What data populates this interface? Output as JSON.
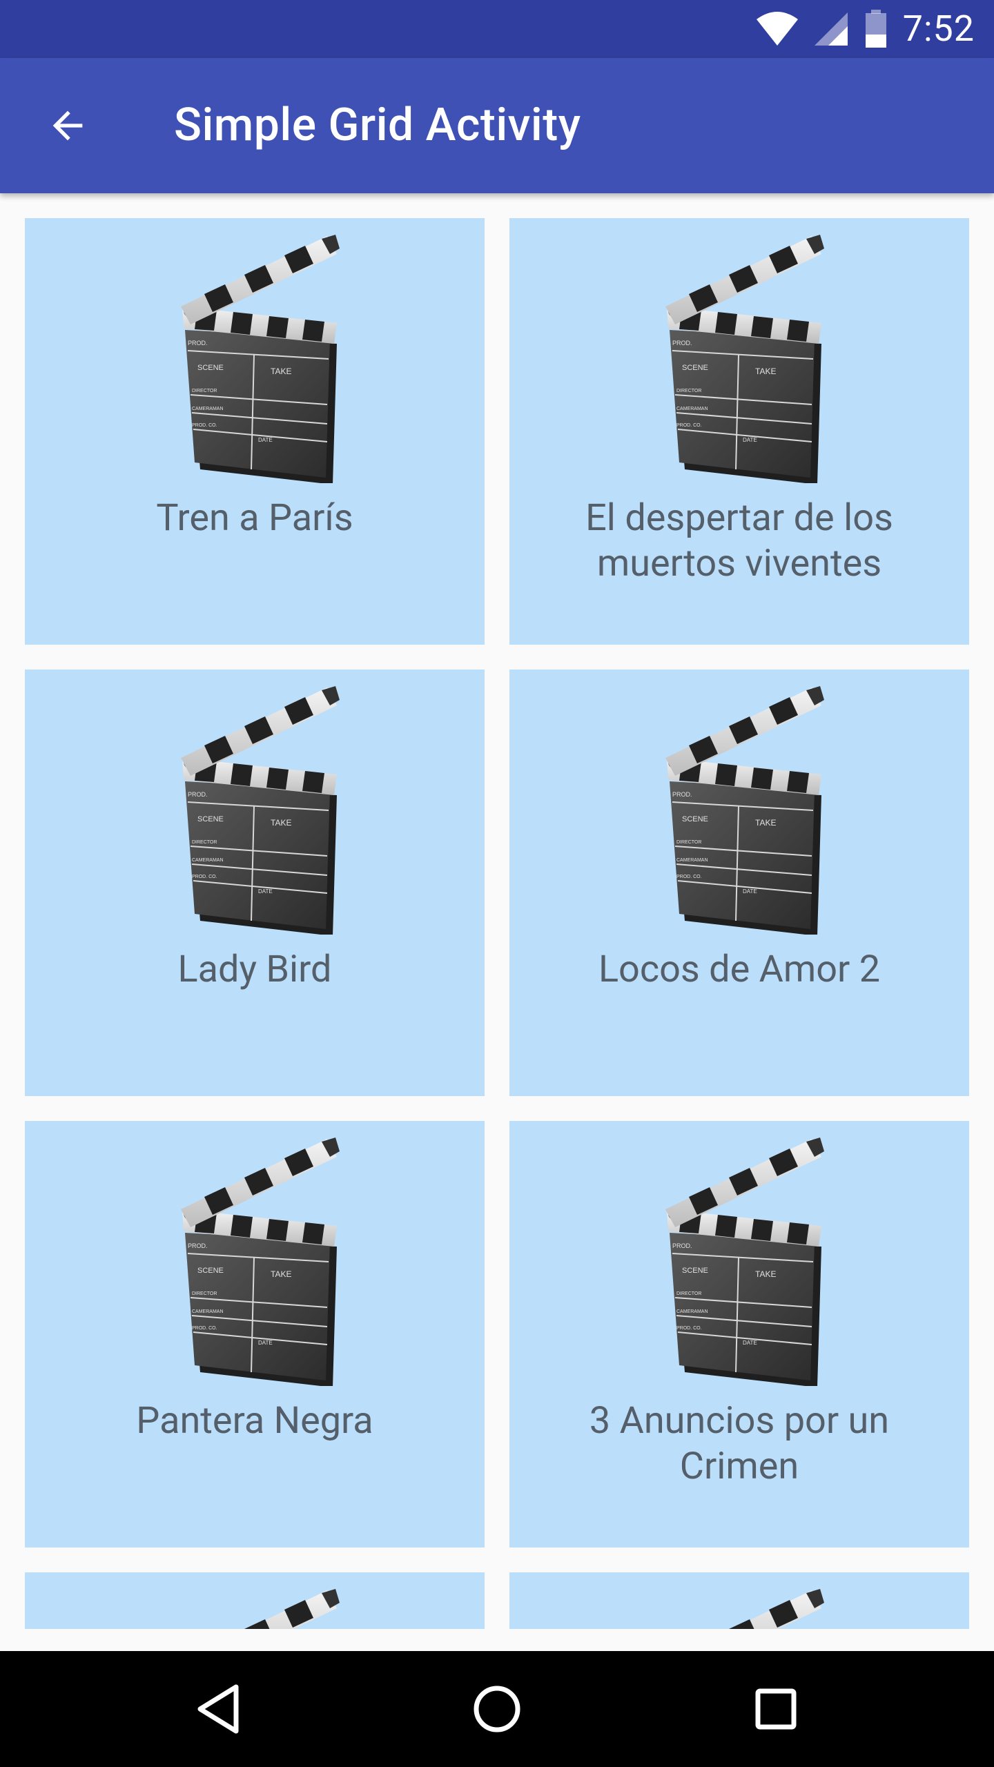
{
  "status_bar": {
    "time": "7:52",
    "icons": [
      "wifi-icon",
      "cell-signal-icon",
      "battery-icon"
    ]
  },
  "app_bar": {
    "title": "Simple Grid Activity",
    "back_icon": "arrow-back-icon"
  },
  "movies": [
    {
      "title": "Tren a París",
      "icon": "clapperboard-icon"
    },
    {
      "title": "El despertar de los muertos viventes",
      "icon": "clapperboard-icon"
    },
    {
      "title": "Lady Bird",
      "icon": "clapperboard-icon"
    },
    {
      "title": "Locos de Amor 2",
      "icon": "clapperboard-icon"
    },
    {
      "title": "Pantera Negra",
      "icon": "clapperboard-icon"
    },
    {
      "title": "3 Anuncios por un Crimen",
      "icon": "clapperboard-icon"
    }
  ],
  "nav_bar": {
    "icons": [
      "back-triangle-icon",
      "home-circle-icon",
      "recents-square-icon"
    ]
  },
  "colors": {
    "status_bar": "#303f9f",
    "app_bar": "#3f51b5",
    "tile_background": "#bbdefb",
    "tile_text": "#545f6a",
    "page_background": "#fafafa"
  }
}
